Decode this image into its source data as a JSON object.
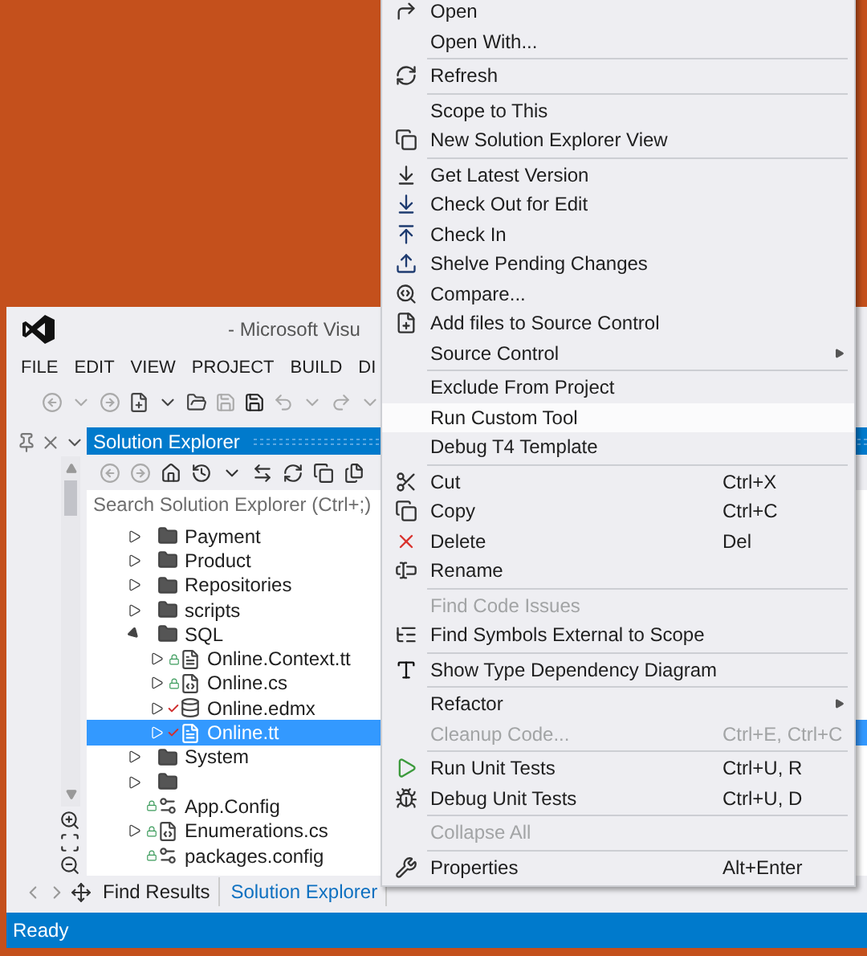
{
  "window": {
    "title": "- Microsoft Visu"
  },
  "menu_bar": [
    {
      "label": "FILE"
    },
    {
      "label": "EDIT"
    },
    {
      "label": "VIEW"
    },
    {
      "label": "PROJECT"
    },
    {
      "label": "BUILD"
    },
    {
      "label": "DI"
    }
  ],
  "solution_explorer": {
    "title": "Solution Explorer",
    "search": {
      "placeholder": "Search Solution Explorer (Ctrl+;)"
    },
    "tree": [
      {
        "name": "Payment",
        "kind": "folder",
        "locked": false,
        "checked_out": false,
        "expandable": true,
        "expanded": false,
        "selected": false
      },
      {
        "name": "Product",
        "kind": "folder",
        "locked": false,
        "checked_out": false,
        "expandable": true,
        "expanded": false,
        "selected": false
      },
      {
        "name": "Repositories",
        "kind": "folder",
        "locked": false,
        "checked_out": false,
        "expandable": true,
        "expanded": false,
        "selected": false
      },
      {
        "name": "scripts",
        "kind": "folder",
        "locked": false,
        "checked_out": false,
        "expandable": true,
        "expanded": false,
        "selected": false
      },
      {
        "name": "SQL",
        "kind": "folder",
        "locked": false,
        "checked_out": false,
        "expandable": true,
        "expanded": true,
        "selected": false,
        "children": [
          {
            "name": "Online.Context.tt",
            "kind": "text",
            "locked": true,
            "checked_out": false,
            "expandable": true,
            "expanded": false,
            "selected": false
          },
          {
            "name": "Online.cs",
            "kind": "code",
            "locked": true,
            "checked_out": false,
            "expandable": true,
            "expanded": false,
            "selected": false
          },
          {
            "name": "Online.edmx",
            "kind": "model",
            "locked": false,
            "checked_out": true,
            "expandable": true,
            "expanded": false,
            "selected": false
          },
          {
            "name": "Online.tt",
            "kind": "text",
            "locked": false,
            "checked_out": true,
            "expandable": true,
            "expanded": false,
            "selected": true
          }
        ]
      },
      {
        "name": "System",
        "kind": "folder",
        "locked": false,
        "checked_out": false,
        "expandable": true,
        "expanded": false,
        "selected": false
      },
      {
        "kind": "folder",
        "locked": false,
        "checked_out": false,
        "expandable": true,
        "expanded": false,
        "selected": false
      },
      {
        "name": "App.Config",
        "kind": "config",
        "locked": true,
        "checked_out": false,
        "expandable": false,
        "selected": false
      },
      {
        "name": "Enumerations.cs",
        "kind": "code",
        "locked": true,
        "checked_out": false,
        "expandable": true,
        "expanded": false,
        "selected": false
      },
      {
        "name": "packages.config",
        "kind": "config",
        "locked": true,
        "checked_out": false,
        "expandable": false,
        "selected": false
      }
    ]
  },
  "bottom_tabs": [
    {
      "label": "Find Results",
      "selected": false
    },
    {
      "label": "Solution Explorer",
      "selected": true
    }
  ],
  "status_bar": {
    "text": "Ready"
  },
  "context_menu": [
    {
      "kind": "item",
      "label": "Open",
      "selected": false,
      "disabled": false,
      "submenu": false
    },
    {
      "kind": "item",
      "label": "Open With...",
      "selected": false,
      "disabled": false,
      "submenu": false
    },
    {
      "kind": "separator"
    },
    {
      "kind": "item",
      "label": "Refresh",
      "selected": false,
      "disabled": false,
      "submenu": false
    },
    {
      "kind": "separator"
    },
    {
      "kind": "item",
      "label": "Scope to This",
      "selected": false,
      "disabled": false,
      "submenu": false
    },
    {
      "kind": "item",
      "label": "New Solution Explorer View",
      "selected": false,
      "disabled": false,
      "submenu": false
    },
    {
      "kind": "separator"
    },
    {
      "kind": "item",
      "label": "Get Latest Version",
      "selected": false,
      "disabled": false,
      "submenu": false
    },
    {
      "kind": "item",
      "label": "Check Out for Edit",
      "selected": false,
      "disabled": false,
      "submenu": false
    },
    {
      "kind": "item",
      "label": "Check In",
      "selected": false,
      "disabled": false,
      "submenu": false
    },
    {
      "kind": "item",
      "label": "Shelve Pending Changes",
      "selected": false,
      "disabled": false,
      "submenu": false
    },
    {
      "kind": "item",
      "label": "Compare...",
      "selected": false,
      "disabled": false,
      "submenu": false
    },
    {
      "kind": "item",
      "label": "Add files to Source Control",
      "selected": false,
      "disabled": false,
      "submenu": false
    },
    {
      "kind": "item",
      "label": "Source Control",
      "selected": false,
      "disabled": false,
      "submenu": true
    },
    {
      "kind": "separator"
    },
    {
      "kind": "item",
      "label": "Exclude From Project",
      "selected": false,
      "disabled": false,
      "submenu": false
    },
    {
      "kind": "item",
      "label": "Run Custom Tool",
      "selected": true,
      "disabled": false,
      "submenu": false
    },
    {
      "kind": "item",
      "label": "Debug T4 Template",
      "selected": false,
      "disabled": false,
      "submenu": false
    },
    {
      "kind": "separator"
    },
    {
      "kind": "item",
      "label": "Cut",
      "shortcut": "Ctrl+X",
      "selected": false,
      "disabled": false,
      "submenu": false
    },
    {
      "kind": "item",
      "label": "Copy",
      "shortcut": "Ctrl+C",
      "selected": false,
      "disabled": false,
      "submenu": false
    },
    {
      "kind": "item",
      "label": "Delete",
      "shortcut": "Del",
      "selected": false,
      "disabled": false,
      "submenu": false
    },
    {
      "kind": "item",
      "label": "Rename",
      "selected": false,
      "disabled": false,
      "submenu": false
    },
    {
      "kind": "separator"
    },
    {
      "kind": "item",
      "label": "Find Code Issues",
      "selected": false,
      "disabled": true,
      "submenu": false
    },
    {
      "kind": "item",
      "label": "Find Symbols External to Scope",
      "selected": false,
      "disabled": false,
      "submenu": false
    },
    {
      "kind": "separator"
    },
    {
      "kind": "item",
      "label": "Show Type Dependency Diagram",
      "selected": false,
      "disabled": false,
      "submenu": false
    },
    {
      "kind": "separator"
    },
    {
      "kind": "item",
      "label": "Refactor",
      "selected": false,
      "disabled": false,
      "submenu": true
    },
    {
      "kind": "item",
      "label": "Cleanup Code...",
      "shortcut": "Ctrl+E, Ctrl+C",
      "selected": false,
      "disabled": true,
      "submenu": false
    },
    {
      "kind": "separator"
    },
    {
      "kind": "item",
      "label": "Run Unit Tests",
      "shortcut": "Ctrl+U, R",
      "selected": false,
      "disabled": false,
      "submenu": false
    },
    {
      "kind": "item",
      "label": "Debug Unit Tests",
      "shortcut": "Ctrl+U, D",
      "selected": false,
      "disabled": false,
      "submenu": false
    },
    {
      "kind": "separator"
    },
    {
      "kind": "item",
      "label": "Collapse All",
      "selected": false,
      "disabled": true,
      "submenu": false
    },
    {
      "kind": "separator"
    },
    {
      "kind": "item",
      "label": "Properties",
      "shortcut": "Alt+Enter",
      "selected": false,
      "disabled": false,
      "submenu": false
    }
  ]
}
